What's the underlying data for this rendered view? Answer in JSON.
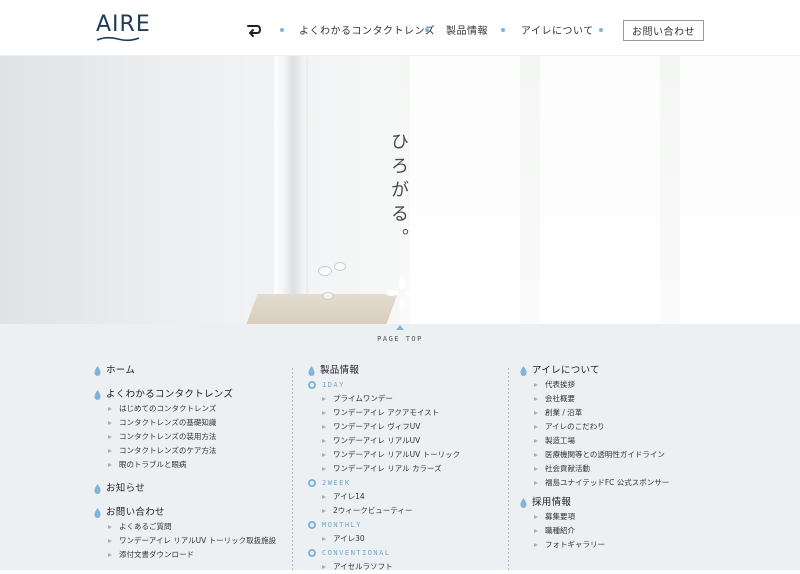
{
  "header": {
    "logo": "AIRE",
    "nav": [
      {
        "label": "よくわかるコンタクトレンズ"
      },
      {
        "label": "製品情報"
      },
      {
        "label": "アイレについて"
      }
    ],
    "contact_label": "お問い合わせ",
    "accent_color": "#7fb5d8"
  },
  "hero": {
    "copy": "ひろがる。"
  },
  "footer": {
    "page_top": "PAGE TOP",
    "col1": {
      "home": "ホーム",
      "lens": {
        "title": "よくわかるコンタクトレンズ",
        "items": [
          "はじめてのコンタクトレンズ",
          "コンタクトレンズの基礎知識",
          "コンタクトレンズの装用方法",
          "コンタクトレンズのケア方法",
          "眼のトラブルと眼病"
        ]
      },
      "news": "お知らせ",
      "contact": {
        "title": "お問い合わせ",
        "items": [
          "よくあるご質問",
          "ワンデーアイレ リアルUV トーリック取扱施設",
          "添付文書ダウンロード"
        ]
      }
    },
    "col2": {
      "title": "製品情報",
      "groups": [
        {
          "category": "1DAY",
          "items": [
            "プライムワンデー",
            "ワンデーアイレ アクアモイスト",
            "ワンデーアイレ ヴィフUV",
            "ワンデーアイレ リアルUV",
            "ワンデーアイレ リアルUV トーリック",
            "ワンデーアイレ リアル カラーズ"
          ]
        },
        {
          "category": "2WEEK",
          "items": [
            "アイレ14",
            "2ウィークビューティー"
          ]
        },
        {
          "category": "MONTHLY",
          "items": [
            "アイレ30"
          ]
        },
        {
          "category": "CONVENTIONAL",
          "items": [
            "アイセルラソフト"
          ]
        }
      ]
    },
    "col3": {
      "about": {
        "title": "アイレについて",
        "items": [
          "代表挨拶",
          "会社概要",
          "創業 / 沿革",
          "アイレのこだわり",
          "製造工場",
          "医療機関等との透明性ガイドライン",
          "社会貢献活動",
          "福島ユナイテッドFC 公式スポンサー"
        ]
      },
      "recruit": {
        "title": "採用情報",
        "items": [
          "募集要項",
          "職種紹介",
          "フォトギャラリー"
        ]
      }
    }
  }
}
